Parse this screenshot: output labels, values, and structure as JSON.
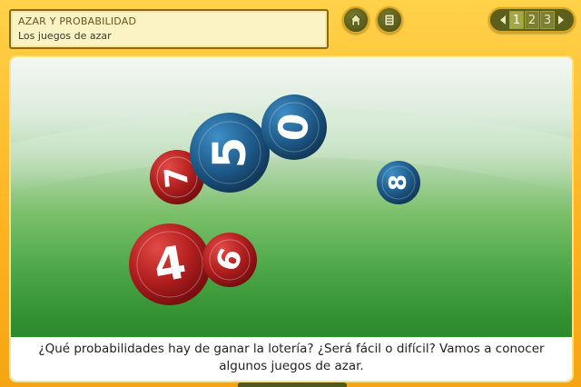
{
  "header": {
    "title": "AZAR Y PROBABILIDAD",
    "subtitle": "Los juegos de azar"
  },
  "toolbar": {
    "home_icon": "home-icon",
    "index_icon": "index-list-icon"
  },
  "pager": {
    "pages": [
      "1",
      "2",
      "3"
    ],
    "current": "1"
  },
  "scene": {
    "balls": [
      {
        "label": "7",
        "color": "#b01e1e"
      },
      {
        "label": "5",
        "color": "#1f5c8c"
      },
      {
        "label": "0",
        "color": "#1f5c8c"
      },
      {
        "label": "8",
        "color": "#1f5c8c"
      },
      {
        "label": "4",
        "color": "#b01e1e"
      },
      {
        "label": "6",
        "color": "#b01e1e"
      }
    ]
  },
  "caption": {
    "text": "¿Qué probabilidades hay de ganar la lotería? ¿Será fácil o difícil? Vamos a conocer algunos juegos de azar."
  },
  "colors": {
    "accent_orange": "#ffb21e",
    "button_olive": "#5c5e1c",
    "ball_red": "#b01e1e",
    "ball_blue": "#1f5c8c"
  }
}
